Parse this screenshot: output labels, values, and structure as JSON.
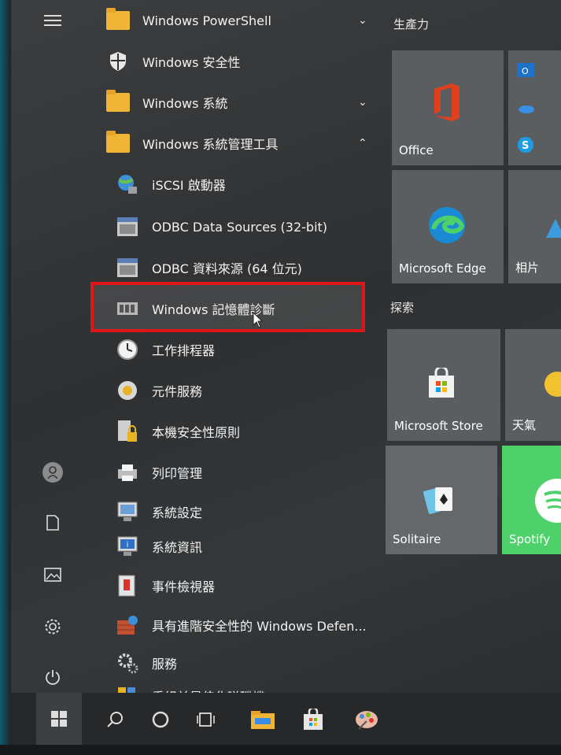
{
  "start_menu": {
    "rail": {
      "icons": [
        "hamburger-icon",
        "user-icon",
        "document-icon",
        "pictures-icon",
        "gear-icon",
        "power-icon"
      ]
    },
    "apps": [
      {
        "label": "Windows PowerShell",
        "icon": "folder-icon",
        "chevron": "⌄"
      },
      {
        "label": "Windows 安全性",
        "icon": "shield-icon",
        "chevron": ""
      },
      {
        "label": "Windows 系統",
        "icon": "folder-icon",
        "chevron": "⌄"
      },
      {
        "label": "Windows 系統管理工具",
        "icon": "folder-icon",
        "chevron": "⌃"
      },
      {
        "label": "iSCSI 啟動器",
        "icon": "iscsi-globe-icon"
      },
      {
        "label": "ODBC Data Sources (32-bit)",
        "icon": "odbc-icon"
      },
      {
        "label": "ODBC 資料來源 (64 位元)",
        "icon": "odbc-icon"
      },
      {
        "label": "Windows 記憶體診斷",
        "icon": "memory-chip-icon",
        "highlighted": true
      },
      {
        "label": "工作排程器",
        "icon": "clock-icon"
      },
      {
        "label": "元件服務",
        "icon": "component-icon"
      },
      {
        "label": "本機安全性原則",
        "icon": "lock-policy-icon"
      },
      {
        "label": "列印管理",
        "icon": "printer-icon"
      },
      {
        "label": "系統設定",
        "icon": "system-config-icon"
      },
      {
        "label": "系統資訊",
        "icon": "system-info-icon"
      },
      {
        "label": "事件檢視器",
        "icon": "event-viewer-icon"
      },
      {
        "label": "具有進階安全性的 Windows Defen...",
        "icon": "firewall-icon"
      },
      {
        "label": "服務",
        "icon": "services-gear-icon"
      },
      {
        "label": "重組並最佳化磁碟機",
        "icon": "defrag-icon"
      }
    ],
    "groups": [
      {
        "title": "生產力"
      },
      {
        "title": "探索"
      }
    ],
    "tiles": {
      "office": "Office",
      "edge": "Microsoft Edge",
      "photos": "相片",
      "store": "Microsoft Store",
      "weather": "天氣",
      "solitaire": "Solitaire",
      "spotify": "Spotify"
    }
  },
  "taskbar": {
    "icons": [
      "windows-start-icon",
      "search-icon",
      "cortana-icon",
      "task-view-icon",
      "file-explorer-icon",
      "store-icon",
      "paint-icon"
    ]
  },
  "colors": {
    "highlight_border": "#e0151a",
    "folder": "#f0b437",
    "spotify_tile": "#4ed06a",
    "office_red": "#e2401c",
    "tile_bg": "#5b5e61"
  }
}
